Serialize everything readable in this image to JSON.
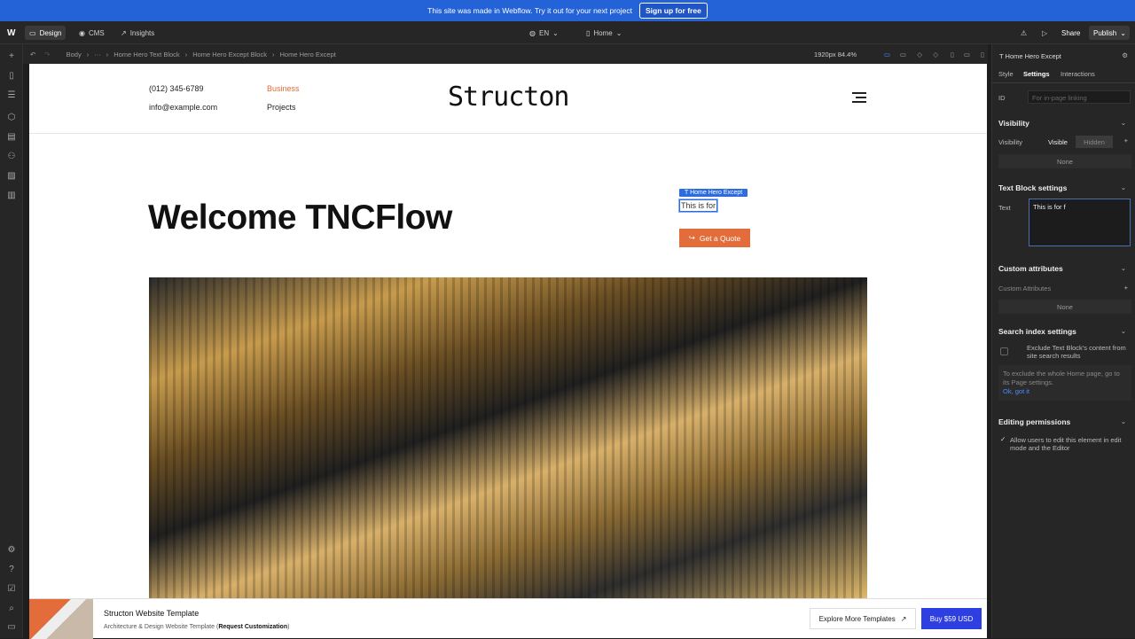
{
  "promo": {
    "text": "This site was made in Webflow.  Try it out for your next project",
    "button": "Sign up for free"
  },
  "topbar": {
    "logo": "W",
    "tabs": [
      {
        "label": "Design"
      },
      {
        "label": "CMS"
      },
      {
        "label": "Insights"
      }
    ],
    "locale": "EN",
    "page": "Home",
    "share": "Share",
    "publish": "Publish"
  },
  "breadcrumbs": [
    "Body",
    "···",
    "Home Hero Text Block",
    "Home Hero Except Block",
    "Home Hero Except"
  ],
  "viewport": "1920px 84.4%",
  "site": {
    "phone": "(012) 345-6789",
    "email": "info@example.com",
    "nav_business": "Business",
    "nav_projects": "Projects",
    "logo": "Structon",
    "headline": "Welcome TNCFlow",
    "selection_tag": "Home Hero Except",
    "edit_text": "This is for",
    "cta": "Get a Quote"
  },
  "panel": {
    "element": "Home Hero Except",
    "tabs": [
      "Style",
      "Settings",
      "Interactions"
    ],
    "id_label": "ID",
    "id_placeholder": "For in-page linking",
    "visibility_title": "Visibility",
    "visibility_label": "Visibility",
    "visible": "Visible",
    "hidden": "Hidden",
    "none": "None",
    "textblock_title": "Text Block settings",
    "text_label": "Text",
    "text_value": "This is for f",
    "custom_attr_title": "Custom attributes",
    "custom_attr_label": "Custom Attributes",
    "search_title": "Search index settings",
    "exclude_label": "Exclude Text Block's content from site search results",
    "exclude_note": "To exclude the whole Home page, go to its Page settings.",
    "ok": "Ok, got it",
    "editing_title": "Editing permissions",
    "editing_label": "Allow users to edit this element in edit mode and the Editor"
  },
  "bottom": {
    "title": "Structon Website Template",
    "subtitle_start": "Architecture & Design Website Template (",
    "subtitle_bold": "Request Customization",
    "subtitle_end": ")",
    "explore": "Explore More Templates",
    "buy": "Buy $59 USD"
  },
  "colors": {
    "accent": "#e36d3a",
    "webflow_blue": "#2462d8",
    "buy": "#2d3fe0"
  }
}
